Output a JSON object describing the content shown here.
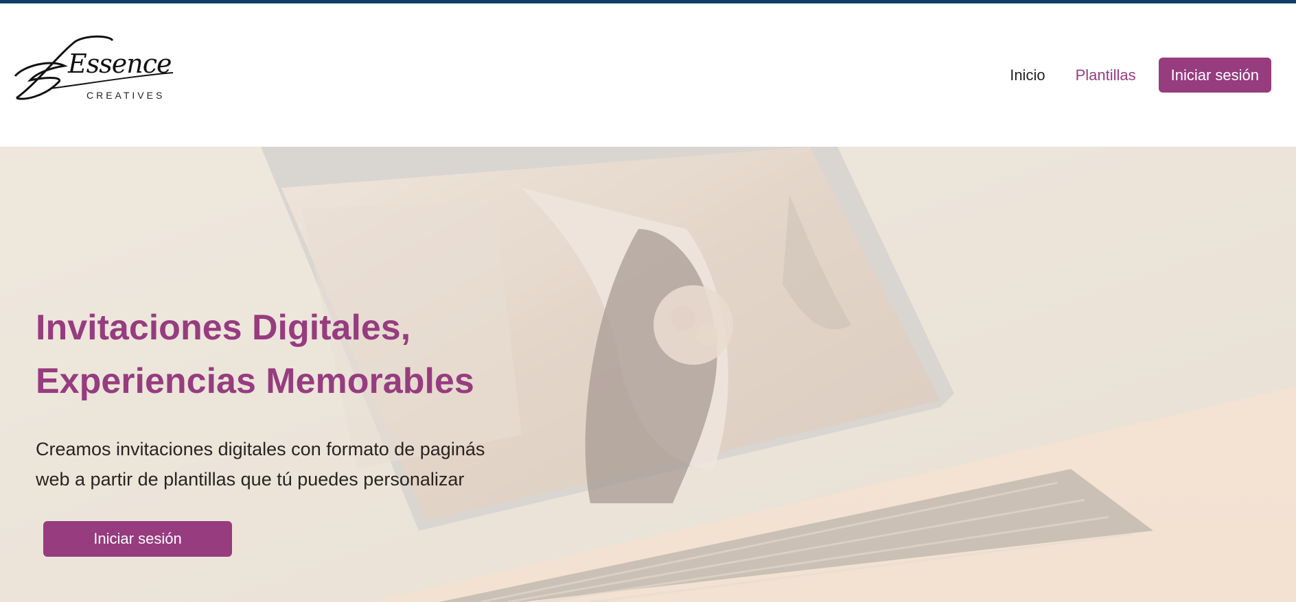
{
  "brand": {
    "logo_word": "Essence",
    "logo_sub": "CREATIVES"
  },
  "nav": {
    "items": [
      {
        "label": "Inicio",
        "active": false
      },
      {
        "label": "Plantillas",
        "active": true
      }
    ],
    "login_label": "Iniciar sesión"
  },
  "hero": {
    "title_line1": "Invitaciones Digitales,",
    "title_line2": "Experiencias Memorables",
    "text_line1": "Creamos invitaciones digitales con formato de paginás",
    "text_line2": "web a partir de plantillas que tú puedes personalizar",
    "cta_label": "Iniciar sesión"
  },
  "colors": {
    "top_strip": "#0f3d66",
    "accent": "#963c7f",
    "text_dark": "#222222"
  },
  "icons": {
    "hero_image": "laptop-with-wedding-photo"
  }
}
